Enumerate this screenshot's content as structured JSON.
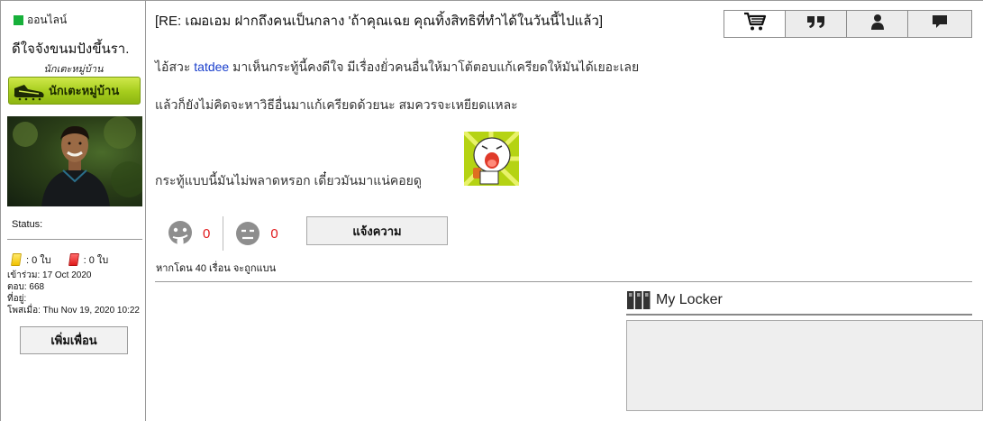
{
  "user": {
    "online_label": "ออนไลน์",
    "name": "ดีใจจังขนมปังขึ้นรา.",
    "rank_title": "นักเตะหมู่บ้าน",
    "rank_badge_label": "นักเตะหมู่บ้าน",
    "status_label": "Status:",
    "yellow_cards": ": 0 ใบ",
    "red_cards": ": 0 ใบ",
    "joined": "เข้าร่วม: 17 Oct 2020",
    "replies": "ตอบ: 668",
    "location": "ที่อยู่:",
    "posted": "โพสเมื่อ: Thu Nov 19, 2020 10:22",
    "add_friend_label": "เพิ่มเพื่อน",
    "online_color": "#17b03a"
  },
  "post": {
    "title": "[RE: เฌอเอม ฝากถึงคนเป็นกลาง 'ถ้าคุณเฉย คุณทิ้งสิทธิที่ทำได้ในวันนี้ไปแล้ว]",
    "line1_before": "ไอ้สวะ ",
    "line1_link": "tatdee",
    "line1_after": " มาเห็นกระทู้นี้คงดีใจ มีเรื่องยั่วคนอื่นให้มาโต้ตอบแก้เครียดให้มันได้เยอะเลย",
    "line2": "แล้วก็ยังไม่คิดจะหาวิธีอื่นมาแก้เครียดด้วยนะ สมควรจะเหยียดแหละ",
    "line3": "กระทู้แบบนี้มันไม่พลาดหรอก เดี๋ยวมันมาแน่คอยดู ",
    "like_count": "0",
    "dislike_count": "0",
    "report_label": "แจ้งความ",
    "ban_warning": "หากโดน 40 เรื่อน จะถูกแบน",
    "link_color": "#1a3fcc",
    "count_color": "#e0191b"
  },
  "tabs": [
    {
      "icon": "cart-icon"
    },
    {
      "icon": "quote-icon"
    },
    {
      "icon": "user-icon"
    },
    {
      "icon": "message-icon"
    }
  ],
  "locker": {
    "title": "My Locker"
  }
}
